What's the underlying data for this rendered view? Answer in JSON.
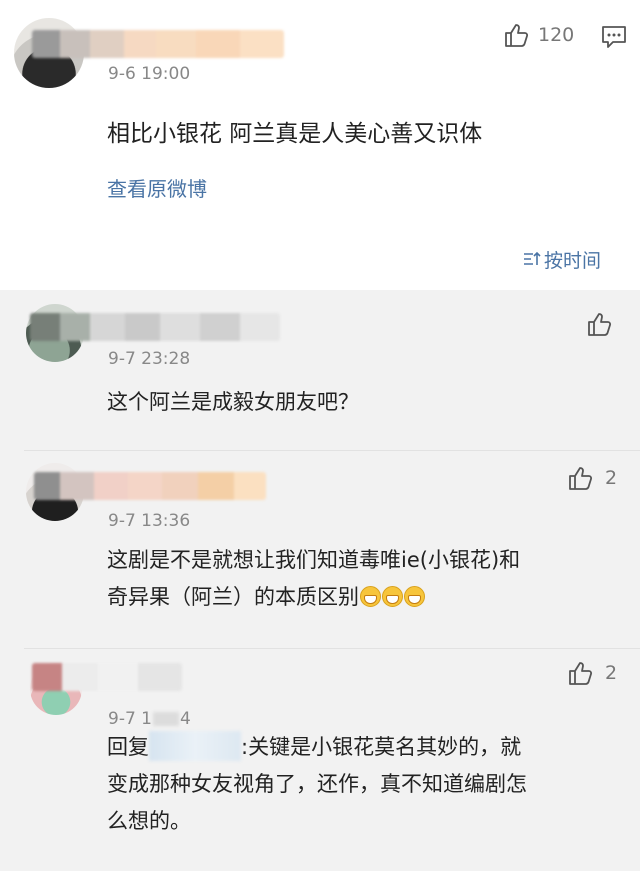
{
  "main_comment": {
    "time": "9-6 19:00",
    "like_count": "120",
    "text": "相比小银花 阿兰真是人美心善又识体",
    "view_original": "查看原微博",
    "sort_label": "按时间",
    "sort_icon": "sort-icon"
  },
  "replies": [
    {
      "time": "9-7 23:28",
      "text": "这个阿兰是成毅女朋友吧？",
      "like_count": ""
    },
    {
      "time": "9-7 13:36",
      "text_line1": "这剧是不是就想让我们知道毒唯ie(小银花)和",
      "text_line2": "奇异果（阿兰）的本质区别",
      "emoji": "grin-emoji",
      "like_count": "2"
    },
    {
      "time": "9-7 1",
      "time_tail": "4",
      "reply_prefix": "回复",
      "text_after_mention": ":关键是小银花莫名其妙的，就",
      "text_line2": "变成那种女友视角了，还作，真不知道编剧怎",
      "text_line3": "么想的。",
      "like_count": "2"
    }
  ],
  "colors": {
    "link": "#4a74a5",
    "reply_bg": "#f2f2f2"
  }
}
